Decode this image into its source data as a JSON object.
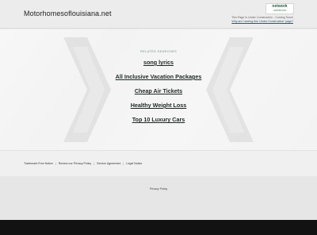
{
  "header": {
    "site_title": "Motorhomesoflouisiana.net",
    "logo": {
      "line1": "network",
      "line2": "solutions"
    },
    "construction_text": "This Page Is Under Construction - Coming Soon!",
    "construction_link": "Why am I seeing this 'Under Construction' page?"
  },
  "main": {
    "related_heading": "RELATED SEARCHES",
    "links": [
      "song lyrics",
      "All Inclusive Vacation Packages",
      "Cheap Air Tickets",
      "Healthy Weight Loss",
      "Top 10 Luxury Cars"
    ]
  },
  "footer": {
    "links": [
      "Trademark Free Notice",
      "Review our Privacy Policy",
      "Service Agreement",
      "Legal Notice"
    ],
    "privacy": "Privacy Policy"
  },
  "colors": {
    "link_text": "#1d2a24",
    "related_heading": "#6a9a86",
    "bottom_bar": "#121212"
  }
}
